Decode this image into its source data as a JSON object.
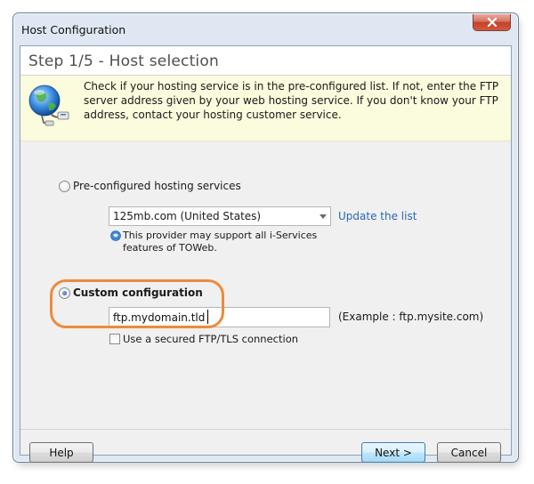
{
  "window": {
    "title": "Host Configuration"
  },
  "step": {
    "title": "Step 1/5 - Host selection"
  },
  "info": {
    "text": "Check if your hosting service is in the pre-configured list. If not, enter the FTP server address given by your web hosting service. If you don't know your FTP address, contact your hosting customer service.",
    "icon": "globe-network-icon"
  },
  "preconfigured": {
    "label": "Pre-configured hosting services",
    "selected": false,
    "provider_value": "125mb.com (United States)",
    "update_link": "Update the list",
    "note": "This provider may support all i-Services features of TOWeb."
  },
  "custom": {
    "label": "Custom configuration",
    "selected": true,
    "ftp_value": "ftp.mydomain.tld",
    "ftp_example": "(Example : ftp.mysite.com)",
    "tls_label": "Use a secured FTP/TLS connection",
    "tls_checked": false
  },
  "buttons": {
    "help": "Help",
    "next": "Next >",
    "cancel": "Cancel"
  },
  "colors": {
    "highlight": "#ef8a3a",
    "link": "#2a66b6",
    "info_bg": "#fbfbde"
  }
}
